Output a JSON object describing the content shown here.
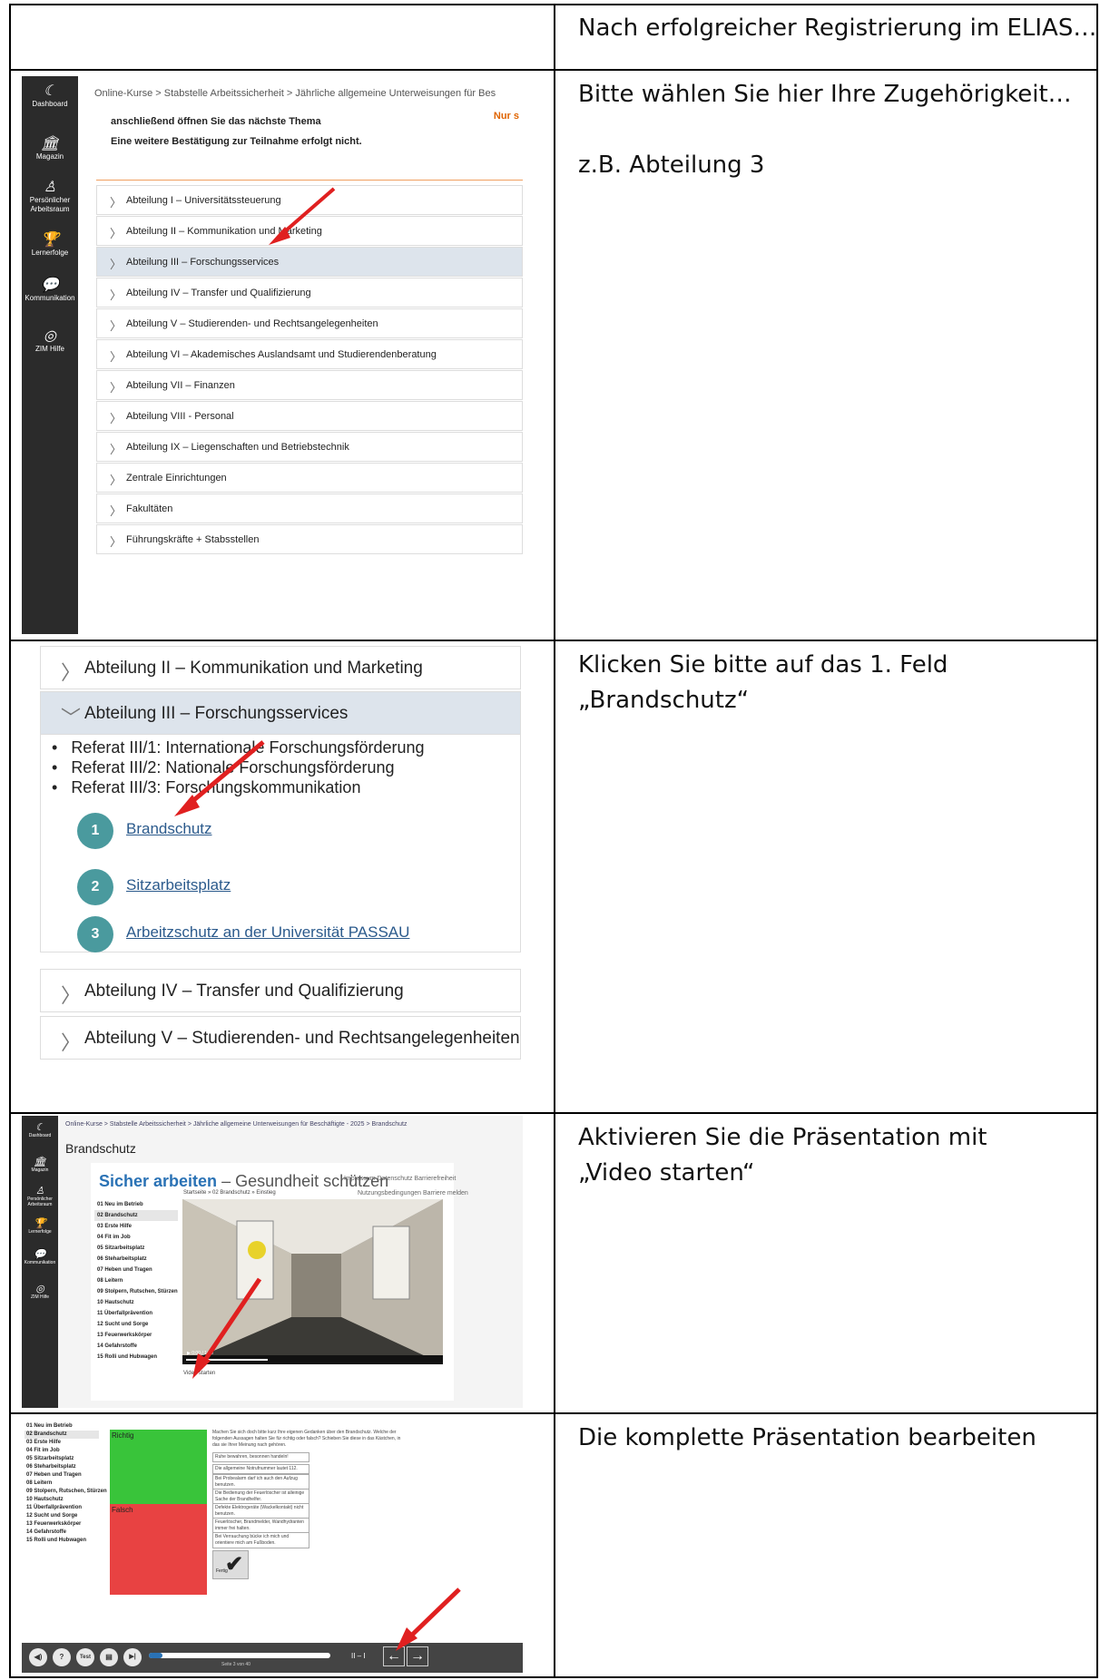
{
  "rows": [
    {
      "text": "Nach erfolgreicher Registrierung im ELIAS…"
    },
    {
      "text": "Bitte wählen Sie hier Ihre Zugehörigkeit…\n\nz.B. Abteilung 3"
    },
    {
      "text": "Klicken Sie bitte auf das 1. Feld\n„Brandschutz“"
    },
    {
      "text": "Aktivieren Sie die Präsentation mit\n „Video starten“"
    },
    {
      "text": "Die komplette Präsentation bearbeiten"
    }
  ],
  "panel1": {
    "sidebar": [
      {
        "icon": "dashboard-icon",
        "glyph": "☾",
        "label": "Dashboard"
      },
      {
        "icon": "magazin-icon",
        "glyph": "🏛",
        "label": "Magazin"
      },
      {
        "icon": "person-icon",
        "glyph": "♙",
        "label": "Persönlicher Arbeitsraum"
      },
      {
        "icon": "trophy-icon",
        "glyph": "🏆",
        "label": "Lernerfolge"
      },
      {
        "icon": "chat-icon",
        "glyph": "💬",
        "label": "Kommunikation"
      },
      {
        "icon": "help-icon",
        "glyph": "◎",
        "label": "ZIM Hilfe"
      }
    ],
    "breadcrumb": "Online-Kurse  >  Stabstelle Arbeitssicherheit  >  Jährliche allgemeine Unterweisungen für Bes",
    "notice": "Nur s",
    "info_line1": "anschließend öffnen Sie das nächste Thema",
    "info_line2": "Eine weitere Bestätigung zur Teilnahme erfolgt nicht.",
    "items": [
      "Abteilung I – Universitätssteuerung",
      "Abteilung II – Kommunikation und Marketing",
      "Abteilung III – Forschungsservices",
      "Abteilung IV – Transfer und Qualifizierung",
      "Abteilung V – Studierenden- und Rechtsangelegenheiten",
      "Abteilung VI – Akademisches Auslandsamt und Studierendenberatung",
      "Abteilung VII – Finanzen",
      "Abteilung VIII - Personal",
      "Abteilung IX – Liegenschaften und Betriebstechnik",
      "Zentrale Einrichtungen",
      "Fakultäten",
      "Führungskräfte + Stabsstellen"
    ]
  },
  "panel2": {
    "acc_top": "Abteilung II – Kommunikation und Marketing",
    "acc_open": "Abteilung III – Forschungsservices",
    "bullets": [
      "Referat III/1: Internationale Forschungsförderung",
      "Referat III/2: Nationale Forschungsförderung",
      "Referat III/3: Forschungskommunikation"
    ],
    "links": [
      {
        "num": "1",
        "label": "Brandschutz"
      },
      {
        "num": "2",
        "label": "Sitzarbeitsplatz"
      },
      {
        "num": "3",
        "label": "Arbeitzschutz an der Universität PASSAU"
      }
    ],
    "acc_b1": "Abteilung IV – Transfer und Qualifizierung",
    "acc_b2": "Abteilung V – Studierenden- und Rechtsangelegenheiten"
  },
  "panel3": {
    "breadcrumb": "Online-Kurse  >  Stabstelle Arbeitssicherheit  >  Jährliche allgemeine Unterweisungen für Beschäftigte - 2025  >  Brandschutz",
    "heading": "Brandschutz",
    "title_main": "Sicher arbeiten",
    "title_sub": " – Gesundheit schützen",
    "top_links": "Impressum  Datenschutz  Barrierefreiheit",
    "top_links2": "Nutzungsbedingungen  Barriere melden",
    "crumb": "Startseite » 02 Brandschutz » Einstieg",
    "video_time": "▶  0:00 / 1:00",
    "video_start": "Video starten"
  },
  "toc": [
    "01 Neu im Betrieb",
    "02 Brandschutz",
    "03 Erste Hilfe",
    "04 Fit im Job",
    "05 Sitzarbeitsplatz",
    "06 Steharbeitsplatz",
    "07 Heben und Tragen",
    "08 Leitern",
    "09 Stolpern, Rutschen, Stürzen",
    "10 Hautschutz",
    "11 Überfallprävention",
    "12 Sucht und Sorge",
    "13 Feuerwerkskörper",
    "14 Gefahrstoffe",
    "15 Rolli und Hubwagen"
  ],
  "panel4": {
    "richtig": "Richtig",
    "falsch": "Falsch",
    "prompt": "Machen Sie sich doch bitte kurz Ihre eigenen Gedanken über den Brandschutz. Welche der folgenden Aussagen halten Sie für richtig oder falsch? Schieben Sie diese in das Kästchen, in das sie Ihrer Meinung nach gehören.",
    "statements": [
      "Ruhe bewahren, besonnen handeln!",
      "Die allgemeine Notrufnummer lautet 112.",
      "Bei Probealarm darf ich auch den Aufzug benutzen.",
      "Die Bedienung der Feuerlöscher ist alleinige Sache der Brandhelfer.",
      "Defekte Elektrogeräte (Wackelkontakt) nicht benutzen.",
      "Feuerlöscher, Brandmelder, Wandhydranten immer frei halten.",
      "Bei Verrauchung bücke ich mich und orientiere mich am Fußboden."
    ],
    "fertig": "Fertig",
    "check": "✔",
    "controls": [
      {
        "icon": "speaker-icon",
        "glyph": "◀)"
      },
      {
        "icon": "question-icon",
        "glyph": "?"
      },
      {
        "icon": "test-icon",
        "glyph": "Test"
      },
      {
        "icon": "document-icon",
        "glyph": "▤"
      },
      {
        "icon": "next-icon",
        "glyph": "▶|"
      }
    ],
    "progress": 0.075,
    "seite": "Seite 3 von 40",
    "pause": "II  –  I",
    "prev": "←",
    "next": "→"
  }
}
